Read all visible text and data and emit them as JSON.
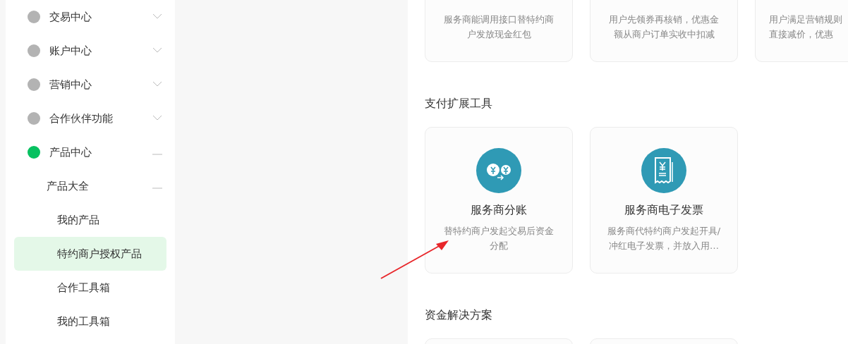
{
  "sidebar": {
    "items": [
      {
        "label": "交易中心",
        "active": false,
        "expanded": false
      },
      {
        "label": "账户中心",
        "active": false,
        "expanded": false
      },
      {
        "label": "营销中心",
        "active": false,
        "expanded": false
      },
      {
        "label": "合作伙伴功能",
        "active": false,
        "expanded": false
      },
      {
        "label": "产品中心",
        "active": true,
        "expanded": true,
        "children": [
          {
            "label": "产品大全",
            "expanded": true,
            "children": [
              {
                "label": "我的产品",
                "selected": false
              },
              {
                "label": "特约商户授权产品",
                "selected": true
              },
              {
                "label": "合作工具箱",
                "selected": false
              },
              {
                "label": "我的工具箱",
                "selected": false
              }
            ]
          }
        ]
      }
    ]
  },
  "sections": [
    {
      "cards": [
        {
          "description": "服务商能调用接口替特约商户发放现金红包"
        },
        {
          "description": "用户先领券再核销，优惠金额从商户订单实收中扣减"
        },
        {
          "description": "用户满足营销规则直接减价，优惠",
          "cut_off": true
        }
      ]
    },
    {
      "title": "支付扩展工具",
      "cards": [
        {
          "kind": "split",
          "title": "服务商分账",
          "description": "替特约商户发起交易后资金分配"
        },
        {
          "kind": "invoice",
          "title": "服务商电子发票",
          "description": "服务商代特约商户发起开具/冲红电子发票，并放入用…"
        }
      ]
    },
    {
      "title": "资金解决方案",
      "cards": [
        {
          "kind": "blank"
        },
        {
          "kind": "blank"
        }
      ]
    }
  ]
}
